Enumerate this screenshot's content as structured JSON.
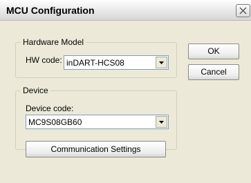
{
  "window": {
    "title": "MCU Configuration"
  },
  "hardware": {
    "legend": "Hardware Model",
    "hw_code_label": "HW code:",
    "hw_code_value": "inDART-HCS08"
  },
  "device": {
    "legend": "Device",
    "device_code_label": "Device code:",
    "device_code_value": "MC9S08GB60",
    "comm_button_label": "Communication Settings"
  },
  "buttons": {
    "ok_label": "OK",
    "cancel_label": "Cancel"
  }
}
